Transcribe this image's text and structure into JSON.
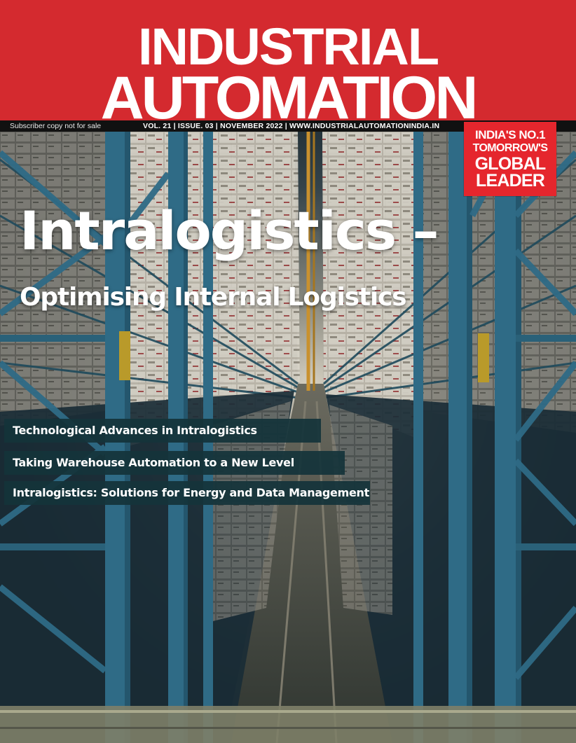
{
  "masthead": {
    "line1": "INDUSTRIAL",
    "line2": "AUTOMATION",
    "color": "#d42a2f"
  },
  "strip": {
    "subscriber": "Subscriber copy not for sale",
    "issue": "VOL. 21 | ISSUE. 03 | NOVEMBER 2022 | WWW.INDUSTRIALAUTOMATIONINDIA.IN"
  },
  "badge": {
    "line1": "INDIA'S NO.1",
    "line2": "TOMORROW'S",
    "line3": "GLOBAL",
    "line4": "LEADER",
    "color": "#e5262d"
  },
  "cover": {
    "headline": "Intralogistics –",
    "subheadline": "Optimising Internal Logistics"
  },
  "teasers": [
    "Technological Advances in Intralogistics",
    "Taking Warehouse Automation to a New Level",
    "Intralogistics: Solutions for Energy and Data Management"
  ]
}
